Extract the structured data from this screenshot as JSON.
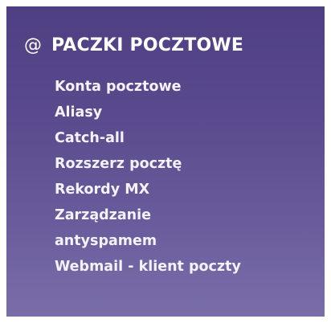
{
  "section": {
    "icon": "at-sign-icon",
    "icon_glyph": "@",
    "title": "PACZKI POCZTOWE"
  },
  "items": [
    {
      "label": "Konta pocztowe"
    },
    {
      "label": "Aliasy"
    },
    {
      "label": "Catch-all"
    },
    {
      "label": "Rozszerz pocztę"
    },
    {
      "label": "Rekordy MX"
    },
    {
      "label": "Zarządzanie"
    },
    {
      "label": "antyspamem"
    },
    {
      "label": "Webmail - klient poczty"
    }
  ],
  "colors": {
    "panel_top": "#4f3f82",
    "panel_bottom": "#7a6ea9",
    "text": "#ffffff"
  }
}
